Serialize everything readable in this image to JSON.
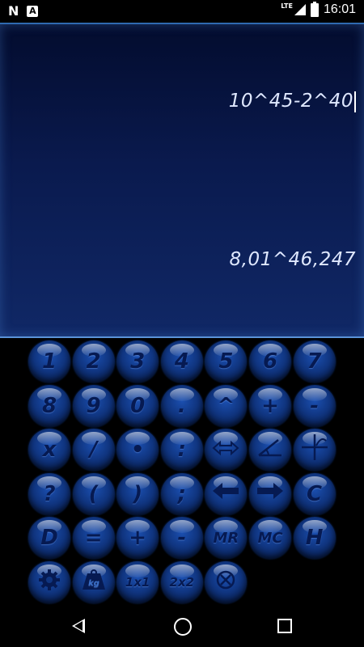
{
  "status_bar": {
    "left_icons": [
      "notification-n-icon",
      "notification-a-icon"
    ],
    "n_label": "N",
    "a_label": "A",
    "network": "LTE",
    "time": "16:01"
  },
  "display": {
    "expression": "10^45-2^40",
    "result": "8,01^46,247"
  },
  "keys": [
    {
      "label": "1",
      "name": "key-1"
    },
    {
      "label": "2",
      "name": "key-2"
    },
    {
      "label": "3",
      "name": "key-3"
    },
    {
      "label": "4",
      "name": "key-4"
    },
    {
      "label": "5",
      "name": "key-5"
    },
    {
      "label": "6",
      "name": "key-6"
    },
    {
      "label": "7",
      "name": "key-7"
    },
    {
      "label": "8",
      "name": "key-8"
    },
    {
      "label": "9",
      "name": "key-9"
    },
    {
      "label": "0",
      "name": "key-0"
    },
    {
      "label": ".",
      "name": "key-decimal"
    },
    {
      "label": "^",
      "name": "key-power"
    },
    {
      "label": "+",
      "name": "key-plus"
    },
    {
      "label": "-",
      "name": "key-minus"
    },
    {
      "label": "x",
      "name": "key-multiply"
    },
    {
      "label": "/",
      "name": "key-divide"
    },
    {
      "label": "•",
      "name": "key-dot-operator"
    },
    {
      "label": ":",
      "name": "key-colon"
    },
    {
      "label": "",
      "name": "key-swap",
      "icon": "double-arrow-icon"
    },
    {
      "label": "",
      "name": "key-angle",
      "icon": "angle-icon"
    },
    {
      "label": "",
      "name": "key-axes",
      "icon": "axes-icon"
    },
    {
      "label": "?",
      "name": "key-question"
    },
    {
      "label": "(",
      "name": "key-open-paren"
    },
    {
      "label": ")",
      "name": "key-close-paren"
    },
    {
      "label": ";",
      "name": "key-semicolon"
    },
    {
      "label": "",
      "name": "key-left",
      "icon": "left-arrow-icon"
    },
    {
      "label": "",
      "name": "key-right",
      "icon": "right-arrow-icon"
    },
    {
      "label": "C",
      "name": "key-clear"
    },
    {
      "label": "D",
      "name": "key-d"
    },
    {
      "label": "=",
      "name": "key-equals"
    },
    {
      "label": "+",
      "name": "key-memory-plus"
    },
    {
      "label": "-",
      "name": "key-memory-minus"
    },
    {
      "label": "MR",
      "name": "key-mr"
    },
    {
      "label": "MC",
      "name": "key-mc"
    },
    {
      "label": "H",
      "name": "key-history"
    },
    {
      "label": "",
      "name": "key-settings",
      "icon": "gear-icon"
    },
    {
      "label": "kg",
      "name": "key-units",
      "icon": "weight-icon"
    },
    {
      "label": "1x1",
      "name": "key-1x1"
    },
    {
      "label": "2x2",
      "name": "key-2x2"
    },
    {
      "label": "",
      "name": "key-close",
      "icon": "circled-x-icon"
    }
  ],
  "nav": {
    "back_icon": "back-triangle-icon",
    "home_icon": "home-circle-icon",
    "recents_icon": "recents-square-icon"
  }
}
